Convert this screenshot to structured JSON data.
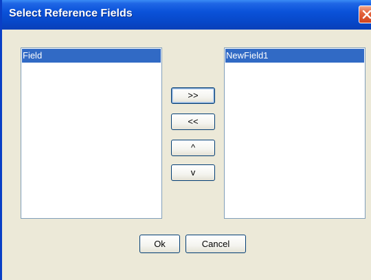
{
  "window": {
    "title": "Select Reference Fields"
  },
  "left_list": {
    "items": [
      "Field"
    ]
  },
  "right_list": {
    "items": [
      "NewField1"
    ]
  },
  "move_buttons": {
    "add_label": ">>",
    "remove_label": "<<",
    "up_label": "^",
    "down_label": "v"
  },
  "footer": {
    "ok_label": "Ok",
    "cancel_label": "Cancel"
  },
  "colors": {
    "titlebar": "#0a52d9",
    "selection": "#316ac5",
    "dialog_bg": "#ece9d8",
    "close_button": "#d1441f"
  }
}
